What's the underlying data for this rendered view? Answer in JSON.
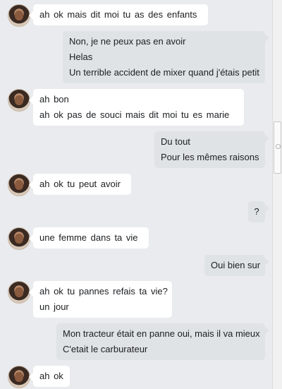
{
  "messages": [
    {
      "direction": "in",
      "lines": [
        "ah  ok  mais  dit  moi  tu  as  des enfants"
      ]
    },
    {
      "direction": "out",
      "lines": [
        "Non, je ne peux pas en avoir",
        "Helas",
        "Un terrible accident de mixer quand j'étais petit"
      ]
    },
    {
      "direction": "in",
      "lines": [
        "ah  bon",
        "ah  ok  pas  de  souci  mais  dit  moi  tu  es  marie"
      ]
    },
    {
      "direction": "out",
      "lines": [
        "Du tout",
        "Pour les mêmes raisons"
      ]
    },
    {
      "direction": "in",
      "lines": [
        "ah  ok  tu  peut avoir"
      ]
    },
    {
      "direction": "out",
      "lines": [
        "?"
      ]
    },
    {
      "direction": "in",
      "lines": [
        "une  femme dans  ta   vie"
      ]
    },
    {
      "direction": "out",
      "lines": [
        "Oui bien sur"
      ]
    },
    {
      "direction": "in",
      "lines": [
        "ah  ok  tu pannes refais  ta  vie?",
        "un  jour"
      ]
    },
    {
      "direction": "out",
      "lines": [
        "Mon tracteur était en panne oui, mais il va mieux",
        "C'etait le carburateur"
      ]
    },
    {
      "direction": "in",
      "lines": [
        "ah  ok"
      ]
    }
  ]
}
